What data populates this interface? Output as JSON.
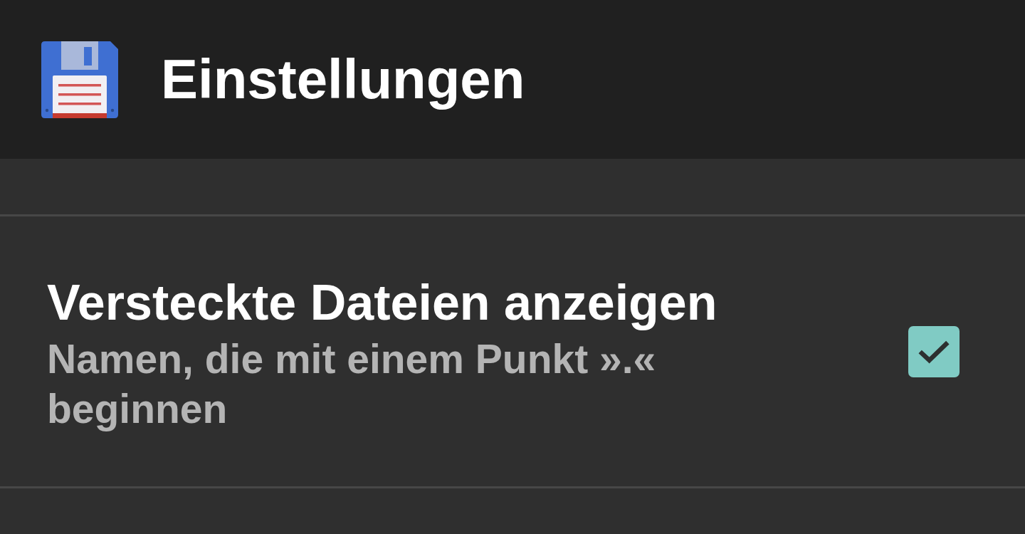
{
  "header": {
    "title": "Einstellungen"
  },
  "preferences": [
    {
      "kind": "checkbox",
      "title": "Versteckte Dateien anzeigen",
      "summary": "Namen, die mit einem Punkt ».« beginnen",
      "checked": true
    }
  ]
}
